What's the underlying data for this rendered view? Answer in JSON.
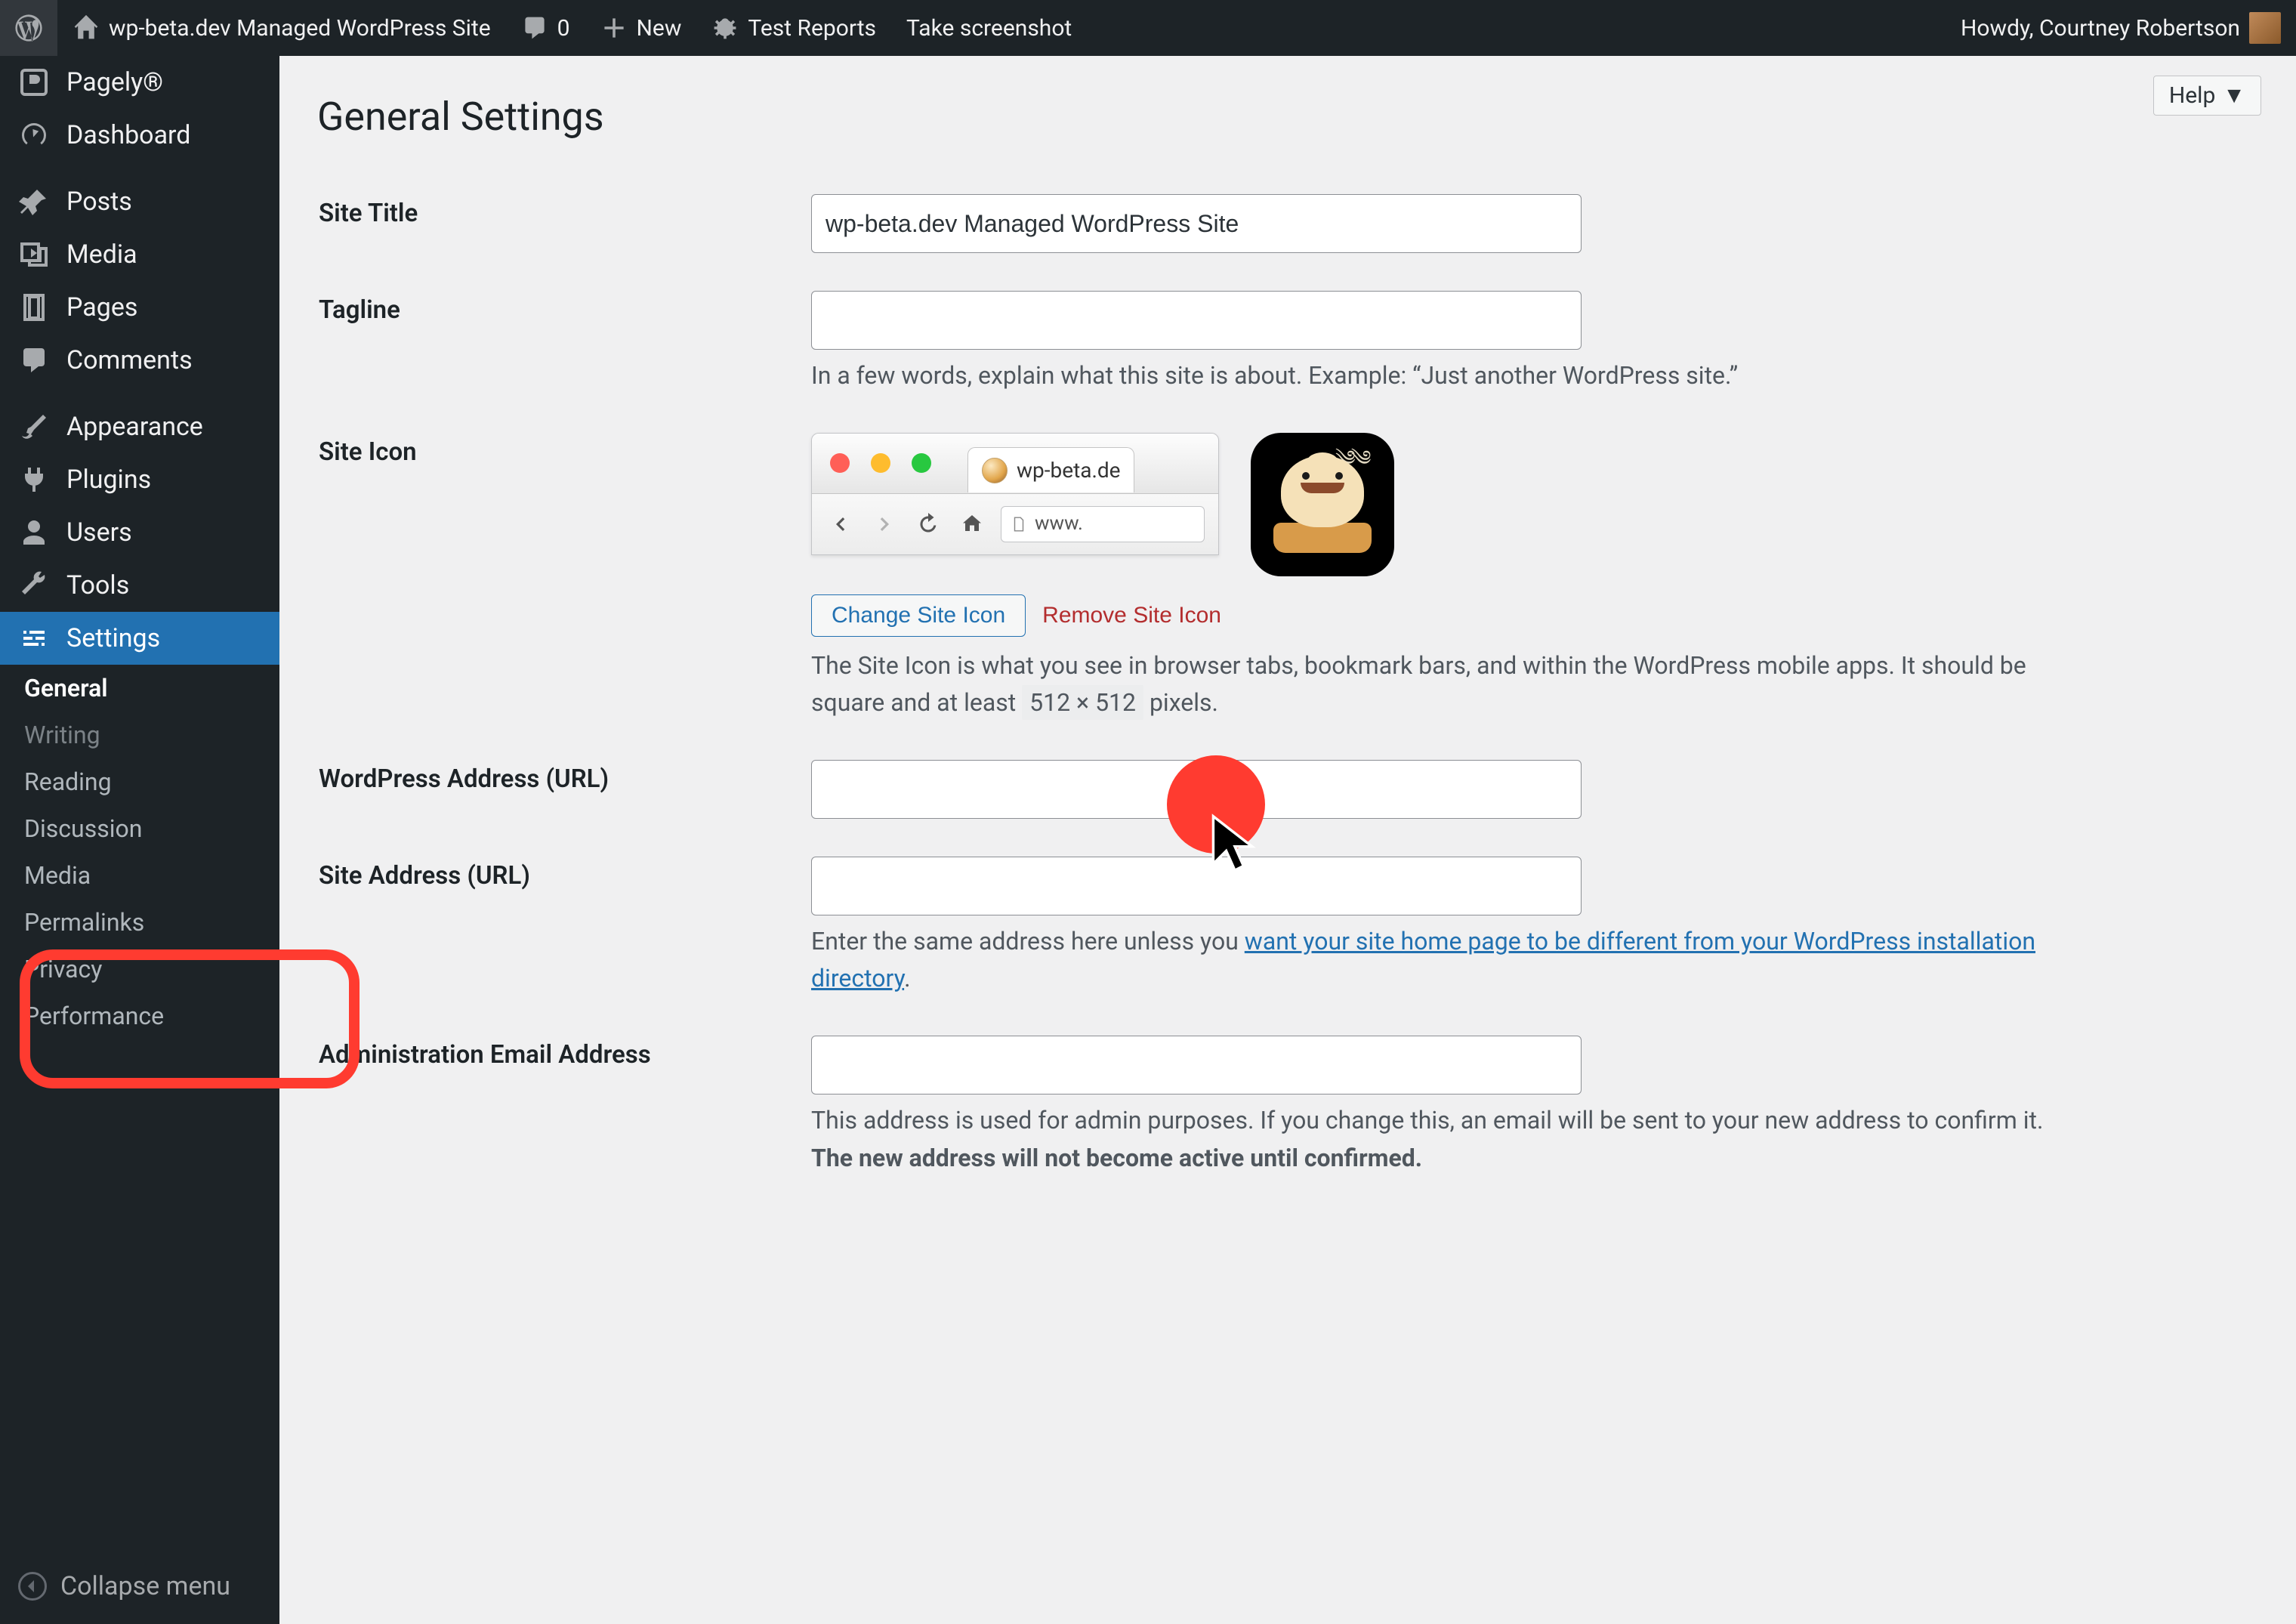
{
  "adminbar": {
    "site_name": "wp-beta.dev Managed WordPress Site",
    "comments_count": "0",
    "new_label": "New",
    "test_reports": "Test Reports",
    "take_screenshot": "Take screenshot",
    "howdy_prefix": "Howdy, ",
    "user_name": "Courtney Robertson"
  },
  "menu": {
    "items": [
      {
        "key": "pagely",
        "label": "Pagely®"
      },
      {
        "key": "dashboard",
        "label": "Dashboard"
      },
      {
        "key": "posts",
        "label": "Posts"
      },
      {
        "key": "media",
        "label": "Media"
      },
      {
        "key": "pages",
        "label": "Pages"
      },
      {
        "key": "comments",
        "label": "Comments"
      },
      {
        "key": "appearance",
        "label": "Appearance"
      },
      {
        "key": "plugins",
        "label": "Plugins"
      },
      {
        "key": "users",
        "label": "Users"
      },
      {
        "key": "tools",
        "label": "Tools"
      },
      {
        "key": "settings",
        "label": "Settings"
      }
    ],
    "submenu": [
      {
        "key": "general",
        "label": "General",
        "current": true
      },
      {
        "key": "writing",
        "label": "Writing"
      },
      {
        "key": "reading",
        "label": "Reading"
      },
      {
        "key": "discussion",
        "label": "Discussion"
      },
      {
        "key": "media",
        "label": "Media"
      },
      {
        "key": "permalinks",
        "label": "Permalinks"
      },
      {
        "key": "privacy",
        "label": "Privacy"
      },
      {
        "key": "performance",
        "label": "Performance"
      }
    ],
    "collapse": "Collapse menu"
  },
  "help_label": "Help",
  "page_title": "General Settings",
  "fields": {
    "site_title": {
      "label": "Site Title",
      "value": "wp-beta.dev Managed WordPress Site"
    },
    "tagline": {
      "label": "Tagline",
      "value": "",
      "description": "In a few words, explain what this site is about. Example: “Just another WordPress site.”"
    },
    "site_icon": {
      "label": "Site Icon",
      "tab_label": "wp-beta.de",
      "url_display": "www.",
      "change_button": "Change Site Icon",
      "remove_button": "Remove Site Icon",
      "description_pre": "The Site Icon is what you see in browser tabs, bookmark bars, and within the WordPress mobile apps. It should be square and at least ",
      "dimensions": "512 × 512",
      "description_post": " pixels."
    },
    "wp_url": {
      "label": "WordPress Address (URL)",
      "value": ""
    },
    "site_url": {
      "label": "Site Address (URL)",
      "value": "",
      "description_pre": "Enter the same address here unless you ",
      "description_link": "want your site home page to be different from your WordPress installation directory",
      "description_post": "."
    },
    "admin_email": {
      "label": "Administration Email Address",
      "value": "",
      "description_pre": "This address is used for admin purposes. If you change this, an email will be sent to your new address to confirm it. ",
      "description_strong": "The new address will not become active until confirmed."
    }
  }
}
